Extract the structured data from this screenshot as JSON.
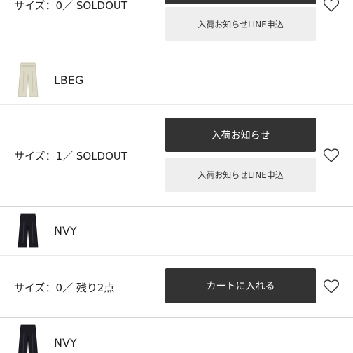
{
  "variants": [
    {
      "size_text": "サイズ：0／ SOLDOUT",
      "line_button": "入荷お知らせLINE申込"
    },
    {
      "color": "LBEG",
      "thumbnail": "beige-wide-pants-thumbnail",
      "size_text": "サイズ：1／ SOLDOUT",
      "notify_button": "入荷お知らせ",
      "line_button": "入荷お知らせLINE申込"
    },
    {
      "color": "NVY",
      "thumbnail": "navy-wide-pants-thumbnail",
      "size_text": "サイズ：0／ 残り2点",
      "cart_button": "カートに入れる"
    },
    {
      "color": "NVY",
      "thumbnail": "navy-wide-pants-thumbnail"
    }
  ],
  "icons": {
    "favorite": "heart-outline-icon"
  },
  "colors": {
    "button_dark": "#333333",
    "button_gray": "#eeeeee",
    "divider": "#d6d6d6"
  }
}
